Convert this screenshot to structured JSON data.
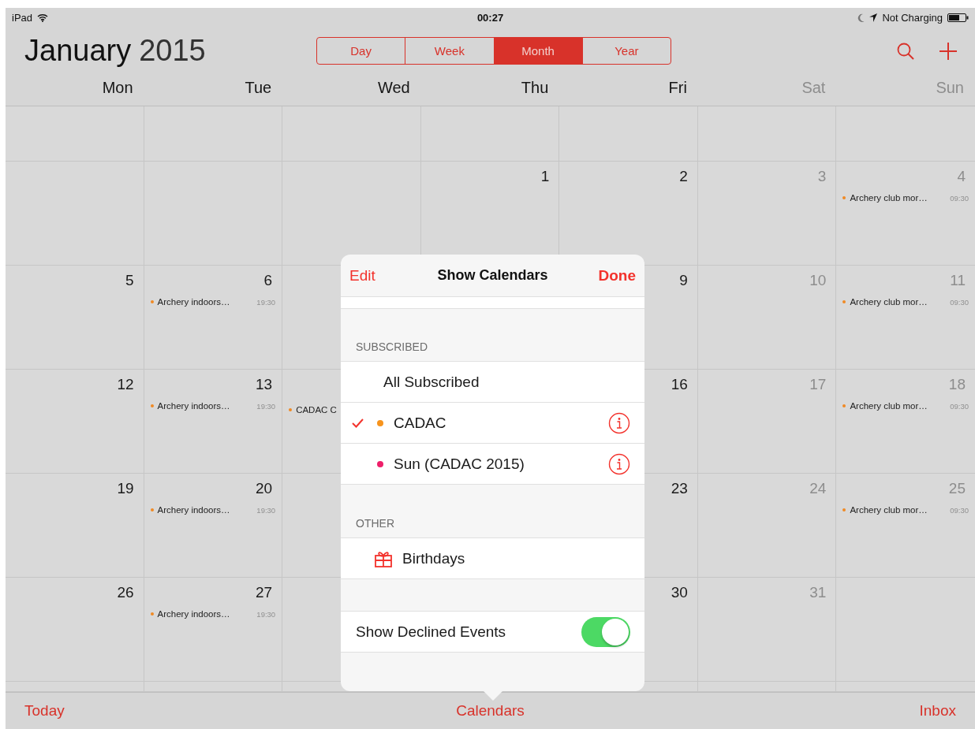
{
  "status_bar": {
    "device": "iPad",
    "time": "00:27",
    "battery_text": "Not Charging"
  },
  "header": {
    "month": "January",
    "year": "2015",
    "views": [
      {
        "label": "Day",
        "selected": false
      },
      {
        "label": "Week",
        "selected": false
      },
      {
        "label": "Month",
        "selected": true
      },
      {
        "label": "Year",
        "selected": false
      }
    ]
  },
  "weekdays": [
    {
      "label": "Mon",
      "weekend": false
    },
    {
      "label": "Tue",
      "weekend": false
    },
    {
      "label": "Wed",
      "weekend": false
    },
    {
      "label": "Thu",
      "weekend": false
    },
    {
      "label": "Fri",
      "weekend": false
    },
    {
      "label": "Sat",
      "weekend": true
    },
    {
      "label": "Sun",
      "weekend": true
    }
  ],
  "weeks": [
    {
      "thu": {
        "day": "1",
        "weekend": false
      },
      "fri": {
        "day": "2",
        "weekend": false
      },
      "sat": {
        "day": "3",
        "weekend": true
      },
      "sun": {
        "day": "4",
        "weekend": true,
        "events": [
          {
            "title": "Archery club mor…",
            "time": "09:30",
            "color": "#f08a24"
          }
        ]
      }
    },
    {
      "mon": {
        "day": "5",
        "weekend": false
      },
      "tue": {
        "day": "6",
        "weekend": false,
        "events": [
          {
            "title": "Archery indoors…",
            "time": "19:30",
            "color": "#f08a24"
          }
        ]
      },
      "fri": {
        "day": "9",
        "weekend": false
      },
      "sat": {
        "day": "10",
        "weekend": true
      },
      "sun": {
        "day": "11",
        "weekend": true,
        "events": [
          {
            "title": "Archery club mor…",
            "time": "09:30",
            "color": "#f08a24"
          }
        ]
      }
    },
    {
      "mon": {
        "day": "12",
        "weekend": false
      },
      "tue": {
        "day": "13",
        "weekend": false,
        "events": [
          {
            "title": "Archery indoors…",
            "time": "19:30",
            "color": "#f08a24"
          }
        ]
      },
      "wed": {
        "events": [
          {
            "title": "CADAC C",
            "color": "#f08a24"
          }
        ]
      },
      "fri": {
        "day": "16",
        "weekend": false
      },
      "sat": {
        "day": "17",
        "weekend": true
      },
      "sun": {
        "day": "18",
        "weekend": true,
        "events": [
          {
            "title": "Archery club mor…",
            "time": "09:30",
            "color": "#f08a24"
          }
        ]
      }
    },
    {
      "mon": {
        "day": "19",
        "weekend": false
      },
      "tue": {
        "day": "20",
        "weekend": false,
        "events": [
          {
            "title": "Archery indoors…",
            "time": "19:30",
            "color": "#f08a24"
          }
        ]
      },
      "fri": {
        "day": "23",
        "weekend": false
      },
      "sat": {
        "day": "24",
        "weekend": true
      },
      "sun": {
        "day": "25",
        "weekend": true,
        "events": [
          {
            "title": "Archery club mor…",
            "time": "09:30",
            "color": "#f08a24"
          }
        ]
      }
    },
    {
      "mon": {
        "day": "26",
        "weekend": false
      },
      "tue": {
        "day": "27",
        "weekend": false,
        "events": [
          {
            "title": "Archery indoors…",
            "time": "19:30",
            "color": "#f08a24"
          }
        ]
      },
      "fri": {
        "day": "30",
        "weekend": false
      },
      "sat": {
        "day": "31",
        "weekend": true
      }
    }
  ],
  "popover": {
    "left_button": "Edit",
    "title": "Show Calendars",
    "right_button": "Done",
    "sections": [
      {
        "title": "SUBSCRIBED",
        "rows": [
          {
            "kind": "all",
            "label": "All Subscribed",
            "checked": false
          },
          {
            "kind": "calendar",
            "label": "CADAC",
            "checked": true,
            "color": "#f7941d",
            "info": true
          },
          {
            "kind": "calendar",
            "label": "Sun (CADAC 2015)",
            "checked": false,
            "color": "#ee1f6a",
            "info": true
          }
        ]
      },
      {
        "title": "OTHER",
        "rows": [
          {
            "kind": "birthdays",
            "label": "Birthdays",
            "checked": false
          }
        ]
      },
      {
        "rows": [
          {
            "kind": "toggle",
            "label": "Show Declined Events",
            "on": true
          }
        ]
      }
    ]
  },
  "toolbar": {
    "left": "Today",
    "center": "Calendars",
    "right": "Inbox"
  }
}
